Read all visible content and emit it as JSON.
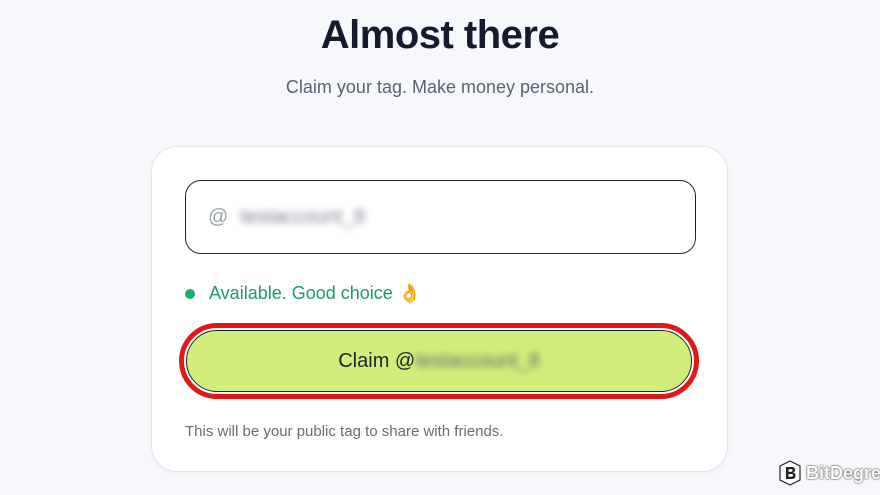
{
  "header": {
    "title": "Almost there",
    "subtitle": "Claim your tag. Make money personal."
  },
  "form": {
    "at_symbol": "@",
    "tag_value": "testaccount_8",
    "status_text": "Available. Good choice",
    "status_emoji": "👌",
    "status_color": "#1a9c63",
    "claim_prefix": "Claim @",
    "claim_tag": "testaccount_8",
    "claim_button_color": "#d2ee7a",
    "highlight_color": "#e01818",
    "hint": "This will be your public tag to share with friends."
  },
  "watermark": {
    "label": "BitDegree",
    "icon": "bitdegree-logo-icon"
  }
}
